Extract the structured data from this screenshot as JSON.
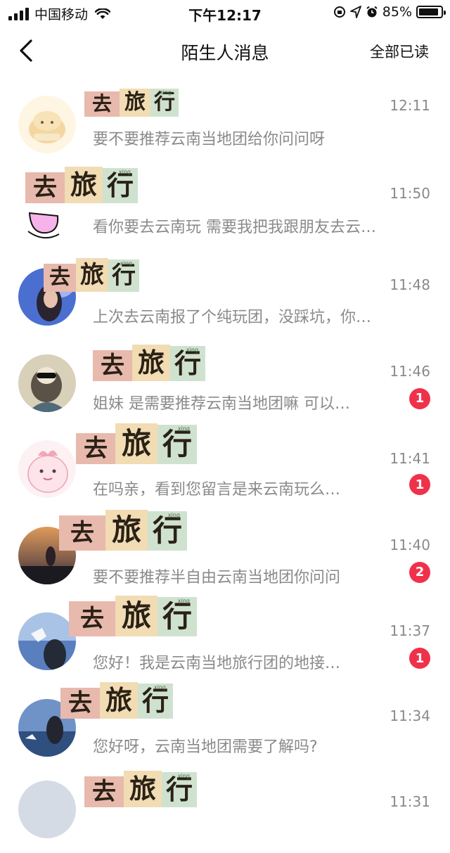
{
  "status_bar": {
    "carrier": "中国移动",
    "time": "下午12:17",
    "battery": "85%",
    "battery_level": 0.85
  },
  "nav": {
    "title": "陌生人消息",
    "action": "全部已读"
  },
  "name_art": {
    "qu": "去",
    "lv": "旅",
    "xing": "行",
    "xing_pinyin": "xing"
  },
  "conversations": [
    {
      "time": "12:11",
      "preview": "要不要推荐云南当地团给你问问呀",
      "badge": ""
    },
    {
      "time": "11:50",
      "preview": "看你要去云南玩 需要我把我跟朋友去云…",
      "badge": ""
    },
    {
      "time": "11:48",
      "preview": "上次去云南报了个纯玩团，没踩坑，你…",
      "badge": ""
    },
    {
      "time": "11:46",
      "preview": "姐妹 是需要推荐云南当地团嘛 可以…",
      "badge": "1"
    },
    {
      "time": "11:41",
      "preview": "在吗亲，看到您留言是来云南玩么…",
      "badge": "1"
    },
    {
      "time": "11:40",
      "preview": "要不要推荐半自由云南当地团你问问",
      "badge": "2"
    },
    {
      "time": "11:37",
      "preview": "您好！我是云南当地旅行团的地接…",
      "badge": "1"
    },
    {
      "time": "11:34",
      "preview": "您好呀，云南当地团需要了解吗?",
      "badge": ""
    },
    {
      "time": "11:31",
      "preview": "",
      "badge": ""
    }
  ],
  "colors": {
    "badge": "#f0314a",
    "muted_text": "#8a8a8a"
  }
}
